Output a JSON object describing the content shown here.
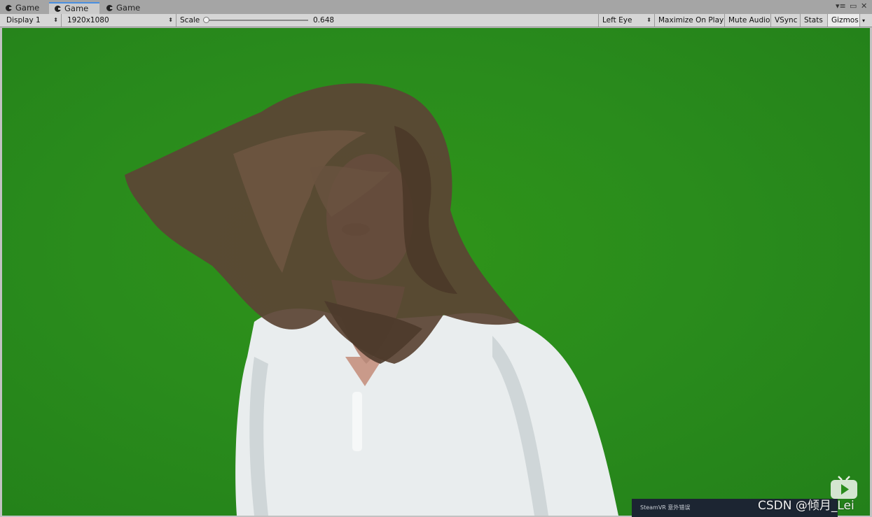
{
  "tabs": [
    {
      "label": "Game",
      "active": false
    },
    {
      "label": "Game",
      "active": true
    },
    {
      "label": "Game",
      "active": false
    }
  ],
  "window_controls": {
    "menu_icon": "menu-icon",
    "maximize_icon": "maximize-icon",
    "close_icon": "close-icon",
    "menu_glyph": "▾≡",
    "maximize_glyph": "▭",
    "close_glyph": "✕"
  },
  "toolbar": {
    "display": "Display 1",
    "resolution": "1920x1080",
    "scale_label": "Scale",
    "scale_value": "0.648",
    "scale_fraction": 0.0,
    "eye": "Left Eye",
    "maximize_on_play": "Maximize On Play",
    "mute_audio": "Mute Audio",
    "vsync": "VSync",
    "stats": "Stats",
    "gizmos": "Gizmos",
    "updown_glyph": "⬍",
    "dropdown_glyph": "▾"
  },
  "overlay": {
    "steamvr_text": "SteamVR 意外错误",
    "watermark": "CSDN @倾月_Lei",
    "play_icon": "video-play-icon"
  },
  "colors": {
    "green_screen": "#2a8c1c",
    "tab_accent": "#4a8fe0"
  }
}
